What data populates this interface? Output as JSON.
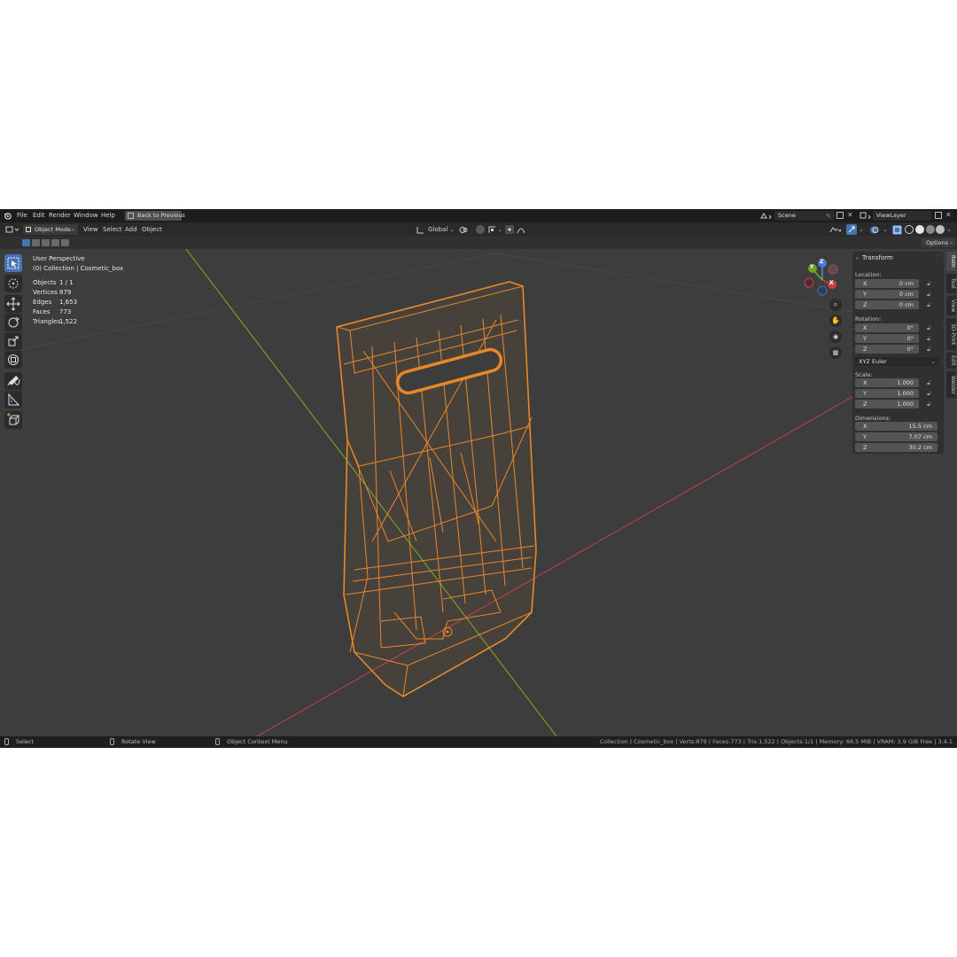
{
  "topbar": {
    "menus": [
      "File",
      "Edit",
      "Render",
      "Window",
      "Help"
    ],
    "back_button": "Back to Previous",
    "scene": "Scene",
    "view_layer": "ViewLayer"
  },
  "header": {
    "mode": "Object Mode",
    "menus": [
      "View",
      "Select",
      "Add",
      "Object"
    ],
    "transform_orientation": "Global",
    "options": "Options"
  },
  "viewport": {
    "perspective": "User Perspective",
    "collection": "(0) Collection | Cosmetic_box",
    "stats": [
      {
        "label": "Objects",
        "value": "1 / 1"
      },
      {
        "label": "Vertices",
        "value": "879"
      },
      {
        "label": "Edges",
        "value": "1,653"
      },
      {
        "label": "Faces",
        "value": "773"
      },
      {
        "label": "Triangles",
        "value": "1,522"
      }
    ],
    "gizmo": {
      "x": "X",
      "y": "Y",
      "z": "Z"
    }
  },
  "sidebar": {
    "panel_title": "Transform",
    "location_label": "Location:",
    "location": [
      {
        "axis": "X",
        "value": "0 cm"
      },
      {
        "axis": "Y",
        "value": "0 cm"
      },
      {
        "axis": "Z",
        "value": "0 cm"
      }
    ],
    "rotation_label": "Rotation:",
    "rotation": [
      {
        "axis": "X",
        "value": "0°"
      },
      {
        "axis": "Y",
        "value": "0°"
      },
      {
        "axis": "Z",
        "value": "0°"
      }
    ],
    "rotation_mode": "XYZ Euler",
    "scale_label": "Scale:",
    "scale": [
      {
        "axis": "X",
        "value": "1.000"
      },
      {
        "axis": "Y",
        "value": "1.000"
      },
      {
        "axis": "Z",
        "value": "1.000"
      }
    ],
    "dimensions_label": "Dimensions:",
    "dimensions": [
      {
        "axis": "X",
        "value": "15.5 cm"
      },
      {
        "axis": "Y",
        "value": "7.07 cm"
      },
      {
        "axis": "Z",
        "value": "30.2 cm"
      }
    ],
    "tabs": [
      "Item",
      "Tool",
      "View",
      "3D-Print",
      "Edit",
      "Welder"
    ]
  },
  "statusbar": {
    "select": "Select",
    "rotate": "Rotate View",
    "context": "Object Context Menu",
    "info": "Collection | Cosmetic_box | Verts:879 | Faces:773 | Tris:1,522 | Objects:1/1 | Memory: 66.5 MiB | VRAM: 3.9 GiB Free | 3.4.1"
  },
  "colors": {
    "selection_orange": "#e8872a",
    "axis_x_red": "#c8404a",
    "axis_y_green": "#7fae2a",
    "active_tool_blue": "#4772b3"
  }
}
